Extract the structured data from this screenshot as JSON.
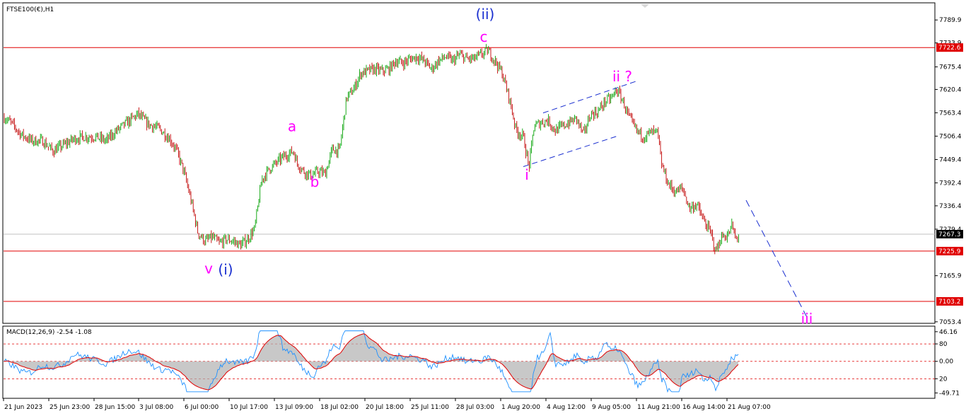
{
  "chart_data": [
    {
      "type": "candlestick",
      "title": "FTSE100(€),H1",
      "y_ticks": [
        7789.9,
        7733.9,
        7675.4,
        7620.4,
        7563.4,
        7506.4,
        7449.4,
        7392.4,
        7336.4,
        7279.4,
        7165.9,
        7053.4
      ],
      "ylim": [
        7045,
        7800
      ],
      "x_ticks": [
        "21 Jun 2023",
        "25 Jun 23:00",
        "28 Jun 15:00",
        "3 Jul 08:00",
        "6 Jul 00:00",
        "10 Jul 17:00",
        "13 Jul 09:00",
        "18 Jul 02:00",
        "20 Jul 18:00",
        "25 Jul 11:00",
        "28 Jul 03:00",
        "1 Aug 20:00",
        "4 Aug 12:00",
        "9 Aug 05:00",
        "11 Aug 21:00",
        "16 Aug 14:00",
        "21 Aug 07:00"
      ],
      "bull_color": "#00a000",
      "bear_color": "#c00000",
      "price_path": [
        [
          0,
          7560
        ],
        [
          15,
          7540
        ],
        [
          30,
          7510
        ],
        [
          45,
          7495
        ],
        [
          60,
          7495
        ],
        [
          75,
          7470
        ],
        [
          90,
          7485
        ],
        [
          105,
          7500
        ],
        [
          120,
          7505
        ],
        [
          135,
          7505
        ],
        [
          150,
          7495
        ],
        [
          165,
          7520
        ],
        [
          180,
          7540
        ],
        [
          195,
          7560
        ],
        [
          210,
          7535
        ],
        [
          225,
          7525
        ],
        [
          240,
          7500
        ],
        [
          250,
          7470
        ],
        [
          260,
          7420
        ],
        [
          270,
          7350
        ],
        [
          280,
          7270
        ],
        [
          290,
          7250
        ],
        [
          300,
          7260
        ],
        [
          310,
          7245
        ],
        [
          320,
          7255
        ],
        [
          330,
          7250
        ],
        [
          340,
          7240
        ],
        [
          350,
          7255
        ],
        [
          360,
          7280
        ],
        [
          370,
          7400
        ],
        [
          380,
          7425
        ],
        [
          390,
          7440
        ],
        [
          400,
          7455
        ],
        [
          410,
          7465
        ],
        [
          415,
          7470
        ],
        [
          420,
          7440
        ],
        [
          430,
          7420
        ],
        [
          440,
          7410
        ],
        [
          450,
          7420
        ],
        [
          460,
          7415
        ],
        [
          470,
          7475
        ],
        [
          480,
          7470
        ],
        [
          490,
          7600
        ],
        [
          500,
          7620
        ],
        [
          510,
          7660
        ],
        [
          520,
          7665
        ],
        [
          530,
          7670
        ],
        [
          540,
          7665
        ],
        [
          550,
          7670
        ],
        [
          560,
          7690
        ],
        [
          570,
          7685
        ],
        [
          580,
          7695
        ],
        [
          590,
          7700
        ],
        [
          600,
          7690
        ],
        [
          610,
          7670
        ],
        [
          620,
          7690
        ],
        [
          630,
          7700
        ],
        [
          640,
          7690
        ],
        [
          650,
          7705
        ],
        [
          660,
          7695
        ],
        [
          670,
          7695
        ],
        [
          680,
          7705
        ],
        [
          690,
          7715
        ],
        [
          700,
          7690
        ],
        [
          710,
          7660
        ],
        [
          720,
          7600
        ],
        [
          730,
          7520
        ],
        [
          740,
          7505
        ],
        [
          748,
          7430
        ],
        [
          755,
          7530
        ],
        [
          765,
          7540
        ],
        [
          775,
          7545
        ],
        [
          785,
          7520
        ],
        [
          795,
          7530
        ],
        [
          805,
          7540
        ],
        [
          815,
          7550
        ],
        [
          825,
          7510
        ],
        [
          835,
          7560
        ],
        [
          845,
          7565
        ],
        [
          855,
          7590
        ],
        [
          865,
          7600
        ],
        [
          872,
          7620
        ],
        [
          880,
          7595
        ],
        [
          890,
          7550
        ],
        [
          900,
          7520
        ],
        [
          910,
          7505
        ],
        [
          920,
          7515
        ],
        [
          930,
          7515
        ],
        [
          935,
          7440
        ],
        [
          945,
          7390
        ],
        [
          955,
          7370
        ],
        [
          965,
          7380
        ],
        [
          975,
          7330
        ],
        [
          985,
          7340
        ],
        [
          995,
          7300
        ],
        [
          1005,
          7270
        ],
        [
          1012,
          7225
        ],
        [
          1020,
          7260
        ],
        [
          1030,
          7265
        ],
        [
          1035,
          7290
        ],
        [
          1040,
          7255
        ],
        [
          1045,
          7265
        ]
      ],
      "horizontal_levels": [
        {
          "price": 7722.6,
          "label": "7722.6",
          "color": "#e00000"
        },
        {
          "price": 7225.9,
          "label": "7225.9",
          "color": "#e00000"
        },
        {
          "price": 7103.2,
          "label": "7103.2",
          "color": "#e00000"
        },
        {
          "price": 7267.3,
          "label": "7267.3",
          "color": "#c0c0c0"
        }
      ],
      "current_price_label": "7267.3",
      "annotations": [
        {
          "text": "(ii)",
          "color": "#1a2fd0",
          "bar": 686,
          "price": 7792
        },
        {
          "text": "c",
          "color": "#ff00ff",
          "bar": 684,
          "price": 7737
        },
        {
          "text": "a",
          "color": "#ff00ff",
          "bar": 413,
          "price": 7518
        },
        {
          "text": "b",
          "color": "#ff00ff",
          "bar": 445,
          "price": 7383
        },
        {
          "text": "ii ?",
          "color": "#ff00ff",
          "bar": 880,
          "price": 7640
        },
        {
          "text": "i",
          "color": "#ff00ff",
          "bar": 745,
          "price": 7400
        },
        {
          "text": "v",
          "color": "#ff00ff",
          "bar": 295,
          "price": 7171
        },
        {
          "text": "(i)",
          "color": "#1a2fd0",
          "bar": 319,
          "price": 7169
        },
        {
          "text": "iii",
          "color": "#ff00ff",
          "bar": 1141,
          "price": 7049
        }
      ],
      "channel_lines": [
        {
          "from": [
            740,
            7432
          ],
          "to": [
            872,
            7506
          ]
        },
        {
          "from": [
            768,
            7563
          ],
          "to": [
            899,
            7640
          ]
        }
      ],
      "projection_line": {
        "from": [
          1055,
          7350
        ],
        "to": [
          1143,
          7058
        ]
      }
    },
    {
      "type": "macd",
      "title": "MACD(12,26,9) -2.54 -1.08",
      "y_ticks": [
        "46.16",
        "80",
        "0.00",
        "20",
        "-49.71"
      ],
      "levels": [
        80,
        0,
        -80
      ],
      "ylim": [
        -160,
        155
      ],
      "macd_color": "#1e90ff",
      "signal_color": "#e00000",
      "histogram_color": "#b0b0b0"
    }
  ]
}
